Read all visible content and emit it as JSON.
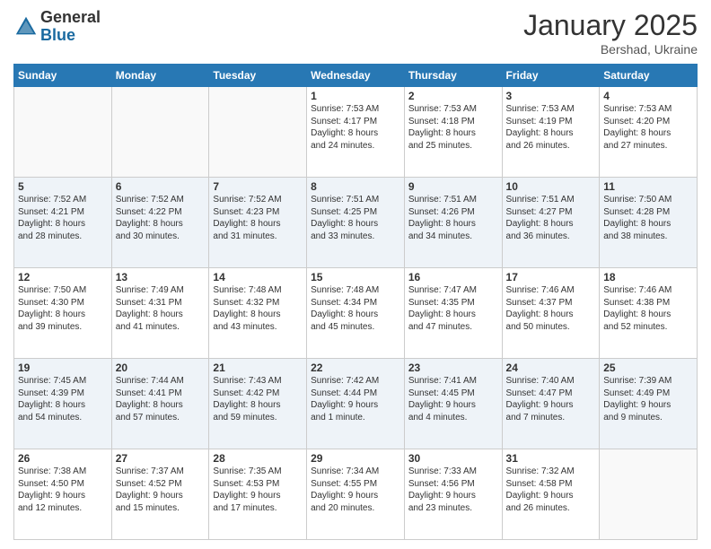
{
  "logo": {
    "general": "General",
    "blue": "Blue"
  },
  "header": {
    "month": "January 2025",
    "location": "Bershad, Ukraine"
  },
  "weekdays": [
    "Sunday",
    "Monday",
    "Tuesday",
    "Wednesday",
    "Thursday",
    "Friday",
    "Saturday"
  ],
  "weeks": [
    [
      {
        "day": "",
        "text": ""
      },
      {
        "day": "",
        "text": ""
      },
      {
        "day": "",
        "text": ""
      },
      {
        "day": "1",
        "text": "Sunrise: 7:53 AM\nSunset: 4:17 PM\nDaylight: 8 hours\nand 24 minutes."
      },
      {
        "day": "2",
        "text": "Sunrise: 7:53 AM\nSunset: 4:18 PM\nDaylight: 8 hours\nand 25 minutes."
      },
      {
        "day": "3",
        "text": "Sunrise: 7:53 AM\nSunset: 4:19 PM\nDaylight: 8 hours\nand 26 minutes."
      },
      {
        "day": "4",
        "text": "Sunrise: 7:53 AM\nSunset: 4:20 PM\nDaylight: 8 hours\nand 27 minutes."
      }
    ],
    [
      {
        "day": "5",
        "text": "Sunrise: 7:52 AM\nSunset: 4:21 PM\nDaylight: 8 hours\nand 28 minutes."
      },
      {
        "day": "6",
        "text": "Sunrise: 7:52 AM\nSunset: 4:22 PM\nDaylight: 8 hours\nand 30 minutes."
      },
      {
        "day": "7",
        "text": "Sunrise: 7:52 AM\nSunset: 4:23 PM\nDaylight: 8 hours\nand 31 minutes."
      },
      {
        "day": "8",
        "text": "Sunrise: 7:51 AM\nSunset: 4:25 PM\nDaylight: 8 hours\nand 33 minutes."
      },
      {
        "day": "9",
        "text": "Sunrise: 7:51 AM\nSunset: 4:26 PM\nDaylight: 8 hours\nand 34 minutes."
      },
      {
        "day": "10",
        "text": "Sunrise: 7:51 AM\nSunset: 4:27 PM\nDaylight: 8 hours\nand 36 minutes."
      },
      {
        "day": "11",
        "text": "Sunrise: 7:50 AM\nSunset: 4:28 PM\nDaylight: 8 hours\nand 38 minutes."
      }
    ],
    [
      {
        "day": "12",
        "text": "Sunrise: 7:50 AM\nSunset: 4:30 PM\nDaylight: 8 hours\nand 39 minutes."
      },
      {
        "day": "13",
        "text": "Sunrise: 7:49 AM\nSunset: 4:31 PM\nDaylight: 8 hours\nand 41 minutes."
      },
      {
        "day": "14",
        "text": "Sunrise: 7:48 AM\nSunset: 4:32 PM\nDaylight: 8 hours\nand 43 minutes."
      },
      {
        "day": "15",
        "text": "Sunrise: 7:48 AM\nSunset: 4:34 PM\nDaylight: 8 hours\nand 45 minutes."
      },
      {
        "day": "16",
        "text": "Sunrise: 7:47 AM\nSunset: 4:35 PM\nDaylight: 8 hours\nand 47 minutes."
      },
      {
        "day": "17",
        "text": "Sunrise: 7:46 AM\nSunset: 4:37 PM\nDaylight: 8 hours\nand 50 minutes."
      },
      {
        "day": "18",
        "text": "Sunrise: 7:46 AM\nSunset: 4:38 PM\nDaylight: 8 hours\nand 52 minutes."
      }
    ],
    [
      {
        "day": "19",
        "text": "Sunrise: 7:45 AM\nSunset: 4:39 PM\nDaylight: 8 hours\nand 54 minutes."
      },
      {
        "day": "20",
        "text": "Sunrise: 7:44 AM\nSunset: 4:41 PM\nDaylight: 8 hours\nand 57 minutes."
      },
      {
        "day": "21",
        "text": "Sunrise: 7:43 AM\nSunset: 4:42 PM\nDaylight: 8 hours\nand 59 minutes."
      },
      {
        "day": "22",
        "text": "Sunrise: 7:42 AM\nSunset: 4:44 PM\nDaylight: 9 hours\nand 1 minute."
      },
      {
        "day": "23",
        "text": "Sunrise: 7:41 AM\nSunset: 4:45 PM\nDaylight: 9 hours\nand 4 minutes."
      },
      {
        "day": "24",
        "text": "Sunrise: 7:40 AM\nSunset: 4:47 PM\nDaylight: 9 hours\nand 7 minutes."
      },
      {
        "day": "25",
        "text": "Sunrise: 7:39 AM\nSunset: 4:49 PM\nDaylight: 9 hours\nand 9 minutes."
      }
    ],
    [
      {
        "day": "26",
        "text": "Sunrise: 7:38 AM\nSunset: 4:50 PM\nDaylight: 9 hours\nand 12 minutes."
      },
      {
        "day": "27",
        "text": "Sunrise: 7:37 AM\nSunset: 4:52 PM\nDaylight: 9 hours\nand 15 minutes."
      },
      {
        "day": "28",
        "text": "Sunrise: 7:35 AM\nSunset: 4:53 PM\nDaylight: 9 hours\nand 17 minutes."
      },
      {
        "day": "29",
        "text": "Sunrise: 7:34 AM\nSunset: 4:55 PM\nDaylight: 9 hours\nand 20 minutes."
      },
      {
        "day": "30",
        "text": "Sunrise: 7:33 AM\nSunset: 4:56 PM\nDaylight: 9 hours\nand 23 minutes."
      },
      {
        "day": "31",
        "text": "Sunrise: 7:32 AM\nSunset: 4:58 PM\nDaylight: 9 hours\nand 26 minutes."
      },
      {
        "day": "",
        "text": ""
      }
    ]
  ]
}
